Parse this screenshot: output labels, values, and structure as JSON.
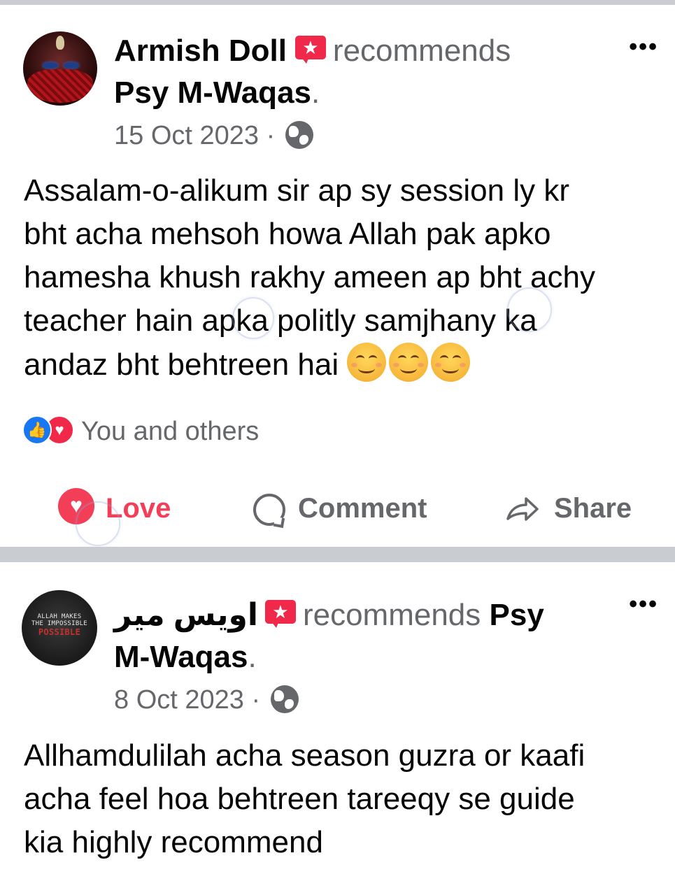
{
  "posts": [
    {
      "author": "Armish Doll",
      "action_text": "recommends",
      "page_name": "Psy M-Waqas",
      "period": ".",
      "date": "15 Oct 2023",
      "separator": "·",
      "more_label": "•••",
      "body_text": "Assalam-o-alikum sir ap sy session ly kr\nbht acha mehsoh howa Allah pak apko\nhamesha khush rakhy ameen ap bht achy\nteacher hain apka politly samjhany ka\nandaz bht behtreen hai ",
      "emoji_count": 3,
      "emoji_name": "smiling-face-with-smiling-eyes",
      "reaction_summary": "You and others",
      "reaction_types": [
        "like",
        "love"
      ],
      "actions": {
        "love_label": "Love",
        "comment_label": "Comment",
        "share_label": "Share"
      }
    },
    {
      "author": "اویس میر",
      "action_text": "recommends",
      "page_name_part1": "Psy",
      "page_name_part2": "M-Waqas",
      "period": ".",
      "date": "8 Oct 2023",
      "separator": "·",
      "more_label": "•••",
      "avatar_text_line1": "ALLAH MAKES",
      "avatar_text_line2": "THE IMPOSSIBLE",
      "avatar_text_line3": "POSSIBLE",
      "body_text": "Allhamdulilah acha season guzra or kaafi\nacha  feel hoa behtreen tareeqy se guide\nkia highly recommend"
    }
  ],
  "icons": {
    "recommend": "recommend-star-bubble-icon",
    "privacy": "globe-icon",
    "more": "more-options-icon",
    "like": "like-thumb-icon",
    "love": "love-heart-icon",
    "comment": "comment-bubble-icon",
    "share": "share-arrow-icon"
  },
  "colors": {
    "recommend_red": "#f02849",
    "love_pink": "#f33e58",
    "like_blue": "#1877f2",
    "muted_text": "#65676b",
    "separator_gray": "#c9ccd1"
  }
}
